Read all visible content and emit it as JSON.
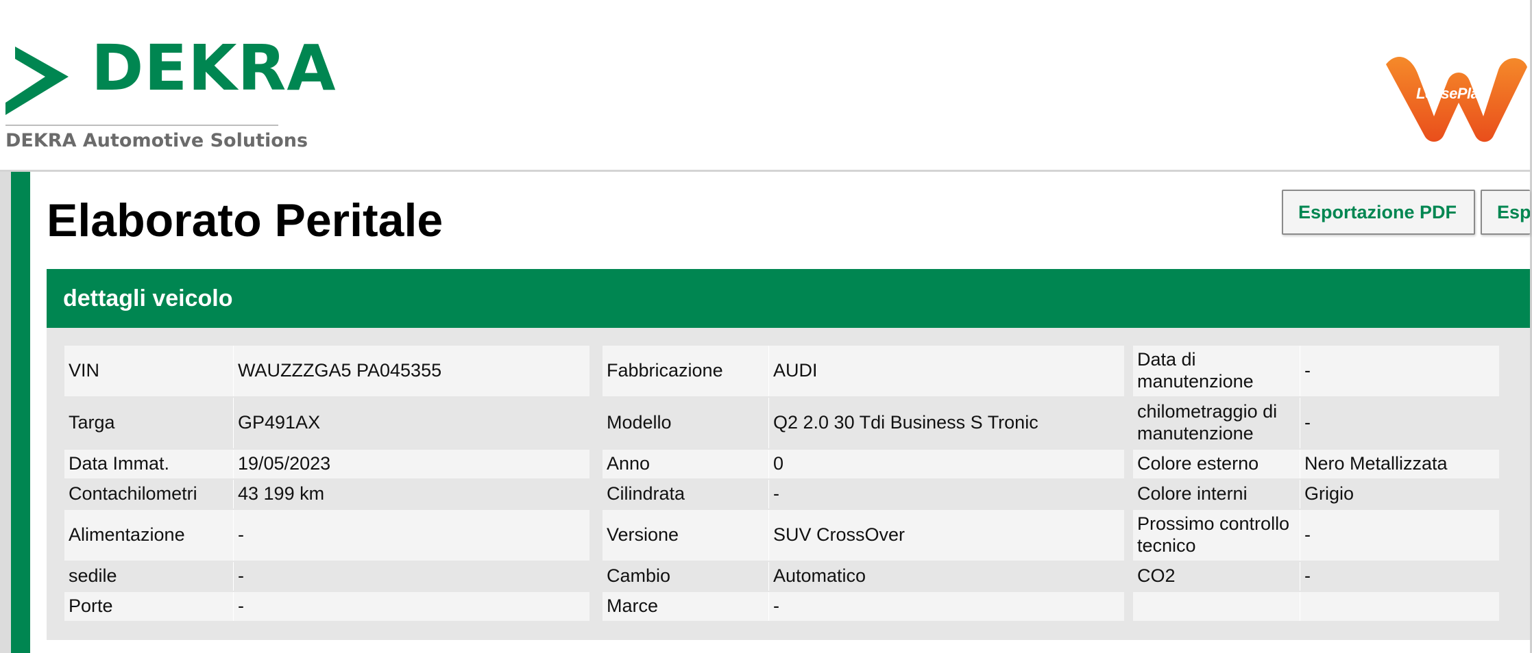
{
  "header": {
    "dekra_word": "DEKRA",
    "dekra_subtitle": "DEKRA Automotive Solutions",
    "leaseplan_word": "LeasePlan",
    "brand_green": "#008651",
    "leaseplan_orange": "#f26b21"
  },
  "page": {
    "title": "Elaborato Peritale",
    "buttons": [
      "Esportazione PDF",
      "Esp"
    ]
  },
  "section": {
    "title": "dettagli veicolo"
  },
  "vehicle": {
    "col1": [
      {
        "label": "VIN",
        "value": "WAUZZZGA5 PA045355"
      },
      {
        "label": "Targa",
        "value": "GP491AX"
      },
      {
        "label": "Data Immat.",
        "value": "19/05/2023"
      },
      {
        "label": "Contachilometri",
        "value": "43 199 km"
      },
      {
        "label": "Alimentazione",
        "value": "-"
      },
      {
        "label": "sedile",
        "value": "-"
      },
      {
        "label": "Porte",
        "value": "-"
      }
    ],
    "col2": [
      {
        "label": "Fabbricazione",
        "value": "AUDI"
      },
      {
        "label": "Modello",
        "value": "Q2 2.0 30 Tdi Business S Tronic"
      },
      {
        "label": "Anno",
        "value": "0"
      },
      {
        "label": "Cilindrata",
        "value": "-"
      },
      {
        "label": "Versione",
        "value": "SUV CrossOver"
      },
      {
        "label": "Cambio",
        "value": "Automatico"
      },
      {
        "label": "Marce",
        "value": "-"
      }
    ],
    "col3": [
      {
        "label": "Data di manutenzione",
        "value": "-"
      },
      {
        "label": "chilometraggio di manutenzione",
        "value": "-"
      },
      {
        "label": "Colore esterno",
        "value": "Nero Metallizzata"
      },
      {
        "label": "Colore interni",
        "value": "Grigio"
      },
      {
        "label": "Prossimo controllo tecnico",
        "value": "-"
      },
      {
        "label": "CO2",
        "value": "-"
      },
      {
        "label": "",
        "value": ""
      }
    ]
  }
}
